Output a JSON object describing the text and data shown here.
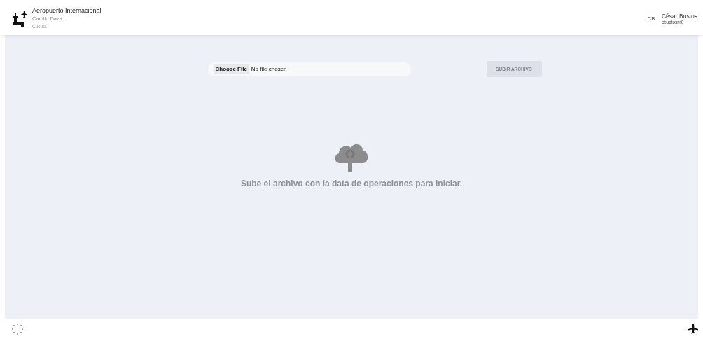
{
  "header": {
    "title": "Aeropuerto Internacional",
    "subtitle": "Camilo Daza",
    "city": "Cúcuta",
    "user": {
      "initials": "CB",
      "name": "César Bustos",
      "username": "cbustosm0"
    }
  },
  "upload": {
    "choose_label": "Choose File",
    "file_status": "No file chosen",
    "submit": {
      "label": "SUBIR ARCHIVO",
      "disabled": true
    }
  },
  "empty_state": {
    "message": "Sube el archivo con la data de operaciones para iniciar."
  }
}
